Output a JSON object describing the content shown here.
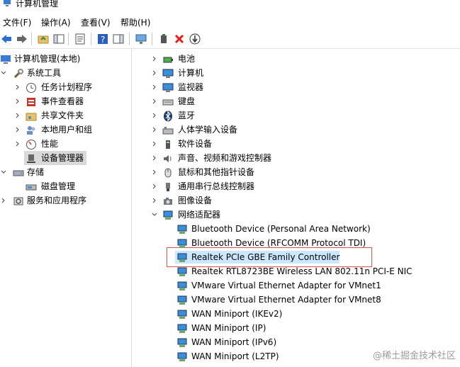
{
  "window": {
    "title": "计算机管理"
  },
  "menu": [
    "文件(F)",
    "操作(A)",
    "查看(V)",
    "帮助(H)"
  ],
  "left_tree": [
    {
      "label": "计算机管理(本地)",
      "icon": "computer-mgmt-icon"
    },
    {
      "label": "系统工具",
      "icon": "tools-icon"
    },
    {
      "label": "任务计划程序",
      "icon": "clock-icon"
    },
    {
      "label": "事件查看器",
      "icon": "event-viewer-icon"
    },
    {
      "label": "共享文件夹",
      "icon": "shared-folder-icon"
    },
    {
      "label": "本地用户和组",
      "icon": "users-icon"
    },
    {
      "label": "性能",
      "icon": "performance-icon"
    },
    {
      "label": "设备管理器",
      "icon": "device-manager-icon"
    },
    {
      "label": "存储",
      "icon": "storage-icon"
    },
    {
      "label": "磁盘管理",
      "icon": "disk-icon"
    },
    {
      "label": "服务和应用程序",
      "icon": "services-icon"
    }
  ],
  "right_tree": [
    {
      "label": "电池",
      "icon": "battery-icon"
    },
    {
      "label": "计算机",
      "icon": "monitor-icon"
    },
    {
      "label": "监视器",
      "icon": "monitor-icon"
    },
    {
      "label": "键盘",
      "icon": "keyboard-icon"
    },
    {
      "label": "蓝牙",
      "icon": "bluetooth-icon"
    },
    {
      "label": "人体学输入设备",
      "icon": "hid-icon"
    },
    {
      "label": "软件设备",
      "icon": "software-device-icon"
    },
    {
      "label": "声音、视频和游戏控制器",
      "icon": "sound-icon"
    },
    {
      "label": "鼠标和其他指针设备",
      "icon": "mouse-icon"
    },
    {
      "label": "通用串行总线控制器",
      "icon": "usb-icon"
    },
    {
      "label": "图像设备",
      "icon": "camera-icon"
    },
    {
      "label": "网络适配器",
      "icon": "network-adapter-icon"
    },
    {
      "label": "Bluetooth Device (Personal Area Network)",
      "icon": "network-adapter-icon"
    },
    {
      "label": "Bluetooth Device (RFCOMM Protocol TDI)",
      "icon": "network-adapter-icon"
    },
    {
      "label": "Realtek PCIe GBE Family Controller",
      "icon": "network-adapter-icon"
    },
    {
      "label": "Realtek RTL8723BE Wireless LAN 802.11n PCI-E NIC",
      "icon": "network-adapter-icon"
    },
    {
      "label": "VMware Virtual Ethernet Adapter for VMnet1",
      "icon": "network-adapter-icon"
    },
    {
      "label": "VMware Virtual Ethernet Adapter for VMnet8",
      "icon": "network-adapter-icon"
    },
    {
      "label": "WAN Miniport (IKEv2)",
      "icon": "network-adapter-icon"
    },
    {
      "label": "WAN Miniport (IP)",
      "icon": "network-adapter-icon"
    },
    {
      "label": "WAN Miniport (IPv6)",
      "icon": "network-adapter-icon"
    },
    {
      "label": "WAN Miniport (L2TP)",
      "icon": "network-adapter-icon"
    }
  ],
  "watermark": "@稀土掘金技术社区",
  "colors": {
    "selection": "#cce8ff",
    "highlight_border": "#d9534f"
  }
}
